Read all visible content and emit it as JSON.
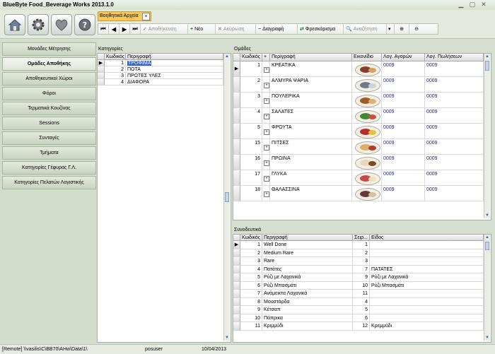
{
  "app": {
    "title": "BlueByte Food_Beverage Works 2013.1.0"
  },
  "window_controls": {
    "minimize": "▁",
    "maximize": "▢",
    "close": "✕"
  },
  "ribbon_icons": [
    "home-icon",
    "settings-gear-icon",
    "heart-icon",
    "help-icon"
  ],
  "tab": {
    "label": "Βοηθητικά Αρχεία",
    "close": "×"
  },
  "toolbar": {
    "first": "⏮",
    "prev": "◀",
    "next": "▶",
    "last": "⏭",
    "save": "Αποθήκευση",
    "new": "Νέο",
    "cancel": "Ακύρωση",
    "delete": "Διαγραφή",
    "refresh": "Φρεσκάρισμα",
    "search": "Αναζήτηση",
    "search_dropdown": "▾",
    "zoom_in": "⊕",
    "zoom_out": "⊖"
  },
  "sidebar": {
    "items": [
      {
        "label": "Μονάδες Μέτρησης"
      },
      {
        "label": "Ομάδες Αποθήκης"
      },
      {
        "label": "Αποθηκευτικοί Χώροι"
      },
      {
        "label": "Φόροι"
      },
      {
        "label": "Τερματικά Κουζίνας"
      },
      {
        "label": "Sessions"
      },
      {
        "label": "Συνταγές"
      },
      {
        "label": "Τμήματα"
      },
      {
        "label": "Κατηγορίες Γέφυρας Γ.Λ."
      },
      {
        "label": "Κατηγορίες Πελατών Λογιστικής"
      }
    ],
    "active_index": 1
  },
  "categories": {
    "title": "Κατηγορίες",
    "columns": [
      "Κωδικός",
      "Περιγραφή"
    ],
    "rows": [
      {
        "code": "1",
        "desc": "ΤΡΟΦΙΜΑ"
      },
      {
        "code": "2",
        "desc": "ΠΟΤΑ"
      },
      {
        "code": "3",
        "desc": "ΠΡΩΤΕΣ ΥΛΕΣ"
      },
      {
        "code": "4",
        "desc": "ΔΙΑΦΟΡΑ"
      }
    ]
  },
  "groups": {
    "title": "Ομάδες",
    "columns": [
      "Κωδικός",
      "+",
      "Περιγραφή",
      "Εικονίδιο",
      "Λογ. Αγορών",
      "Λογ. Πωλήσεων"
    ],
    "rows": [
      {
        "code": "1",
        "desc": "ΚΡΕΑΤΙΚΑ",
        "buy": "0009",
        "sell": "0009",
        "icon": "meat-dish-icon"
      },
      {
        "code": "2",
        "desc": "ΑΛΜΥΡΑ ΨΑΡΙΑ",
        "buy": "0009",
        "sell": "0009",
        "icon": "fish-dish-icon"
      },
      {
        "code": "3",
        "desc": "ΠΟΥΛΕΡΙΚΑ",
        "buy": "0009",
        "sell": "0009",
        "icon": "poultry-dish-icon"
      },
      {
        "code": "4",
        "desc": "ΣΑΛΑΤΕΣ",
        "buy": "0009",
        "sell": "0009",
        "icon": "salad-icon"
      },
      {
        "code": "5",
        "desc": "ΦΡΟΥΤΑ",
        "buy": "0009",
        "sell": "0009",
        "icon": "fruit-icon"
      },
      {
        "code": "15",
        "desc": "ΠΙΤΣΕΣ",
        "buy": "0009",
        "sell": "0009",
        "icon": "pizza-icon"
      },
      {
        "code": "16",
        "desc": "ΠΡΩΙΝΑ",
        "buy": "0009",
        "sell": "0009",
        "icon": "breakfast-icon"
      },
      {
        "code": "17",
        "desc": "ΓΛΥΚΑ",
        "buy": "0009",
        "sell": "0009",
        "icon": "dessert-icon"
      },
      {
        "code": "18",
        "desc": "ΘΑΛΑΣΣΙΝΑ",
        "buy": "0009",
        "sell": "0009",
        "icon": "seafood-icon"
      }
    ]
  },
  "accompaniments": {
    "title": "Συνοδευτικά",
    "columns": [
      "Κωδικός",
      "Περιγραφή",
      "Σειρ...",
      "Είδος"
    ],
    "rows": [
      {
        "code": "1",
        "desc": "Well Done",
        "order": "1",
        "item": ""
      },
      {
        "code": "2",
        "desc": "Medium Rare",
        "order": "2",
        "item": ""
      },
      {
        "code": "3",
        "desc": "Rare",
        "order": "3",
        "item": ""
      },
      {
        "code": "4",
        "desc": "Πατάτες",
        "order": "7",
        "item": "ΠΑΤΑΤΕΣ"
      },
      {
        "code": "5",
        "desc": "Ρύζι με Λαχανικά",
        "order": "9",
        "item": "Ρύζι με Λαχανικά"
      },
      {
        "code": "6",
        "desc": "Ρύζι Μπασμάτι",
        "order": "10",
        "item": "Ρύζι Μπασμάτι"
      },
      {
        "code": "7",
        "desc": "Ανάμεικτα Λαχανικά",
        "order": "11",
        "item": ""
      },
      {
        "code": "8",
        "desc": "Μουστάρδα",
        "order": "4",
        "item": ""
      },
      {
        "code": "9",
        "desc": "Κέτσαπ",
        "order": "5",
        "item": ""
      },
      {
        "code": "10",
        "desc": "Πάπρικα",
        "order": "6",
        "item": ""
      },
      {
        "code": "11",
        "desc": "Κριμμύδι",
        "order": "12",
        "item": "Κρεμμύδι"
      }
    ]
  },
  "statusbar": {
    "path": "[Remote]  \\\\vasilis\\C\\BB70\\AHw\\Data\\1\\",
    "user": "posuser",
    "date": "10/04/2013"
  },
  "colors": {
    "selection": "#3968c4",
    "tab_accent": "#f7c85e",
    "background": "#d6dfcf"
  }
}
